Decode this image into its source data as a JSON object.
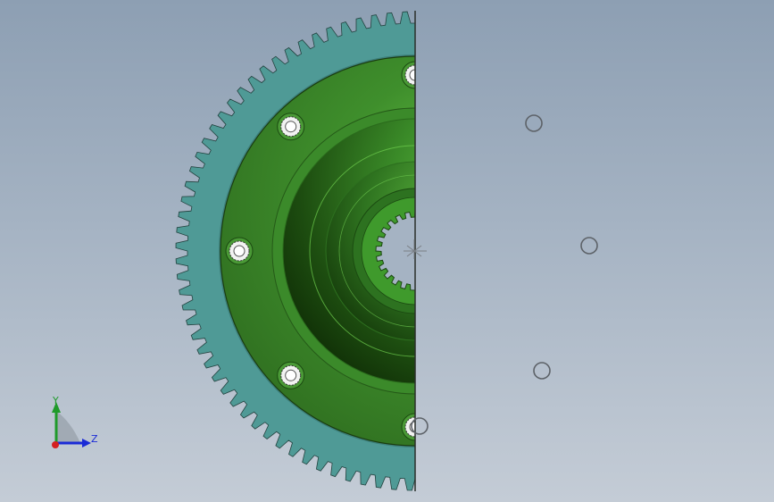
{
  "viewport": {
    "background_top": "#8d9fb3",
    "background_bottom": "#c4ccd6"
  },
  "model": {
    "gear_color": "#4f9a96",
    "hub_color": "#3f8a2f",
    "hub_highlight": "#56b53a",
    "hub_shadow": "#1e4a10",
    "section_view": true
  },
  "triad": {
    "y_label": "Y",
    "z_label": "Z",
    "y_color": "#1f9a2a",
    "z_color": "#1b2bd6",
    "x_color": "#d42020"
  }
}
